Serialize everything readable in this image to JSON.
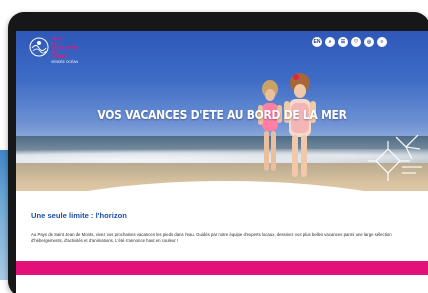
{
  "logo": {
    "line1": "PAYS",
    "line2": "DE",
    "line3": "SAINT JEAN",
    "line4": "DE",
    "line5": "MONTS",
    "line6": "VENDÉE OCÉAN"
  },
  "toolbar": {
    "buttons": [
      {
        "label": "EN",
        "icon": "language-icon"
      },
      {
        "label": "⌕",
        "icon": "search-icon"
      },
      {
        "label": "☰",
        "icon": "menu-icon"
      },
      {
        "label": "♡",
        "icon": "favorites-icon"
      },
      {
        "label": "◎",
        "icon": "location-icon"
      },
      {
        "label": "≡",
        "icon": "more-icon"
      }
    ]
  },
  "hero": {
    "title": "VOS VACANCES D'ETE AU BORD DE LA MER"
  },
  "section": {
    "title": "Une seule limite : l'horizon",
    "body": "Au Pays de Saint Jean de Monts, vivez vos prochaines vacances les pieds dans l'eau. Guidés par notre équipe d'experts locaux, dessinez vos plus belles vacances parmi une large sélection d'hébergements, d'activités et d'animations. L'été s'annonce haut en couleur !"
  },
  "colors": {
    "brand_pink": "#e4107a",
    "brand_blue": "#1e4fa8",
    "device_frame": "#161718"
  }
}
